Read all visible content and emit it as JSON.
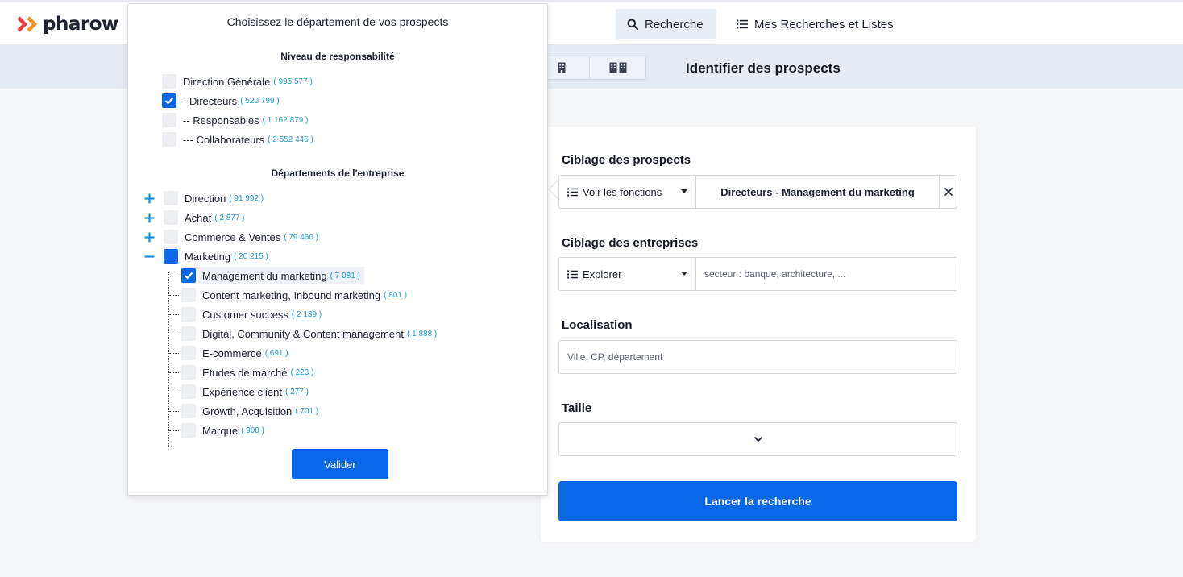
{
  "brand": {
    "name": "pharow",
    "colors": {
      "primary": "#0a67e8",
      "logo_red": "#ee3b3b",
      "logo_orange": "#f7931e",
      "count_blue": "#1b9bd1"
    }
  },
  "nav": {
    "search": {
      "label": "Recherche",
      "icon": "search-icon"
    },
    "lists": {
      "label": "Mes Recherches et Listes",
      "icon": "list-icon"
    }
  },
  "subheader": {
    "title": "Identifier des prospects",
    "view_icons": [
      "building-icon",
      "buildings-icon"
    ]
  },
  "card": {
    "prospects": {
      "title": "Ciblage des prospects",
      "dropdown": "Voir les fonctions",
      "selected": "Directeurs - Management du marketing"
    },
    "companies": {
      "title": "Ciblage des entreprises",
      "dropdown": "Explorer",
      "placeholder": "secteur : banque, architecture, ..."
    },
    "location": {
      "title": "Localisation",
      "placeholder": "Ville, CP, département"
    },
    "size": {
      "title": "Taille",
      "value": ""
    },
    "launch_label": "Lancer la recherche"
  },
  "modal": {
    "title": "Choisissez le département de vos prospects",
    "levels_title": "Niveau de responsabilité",
    "levels": [
      {
        "label": "Direction Générale",
        "count": "( 995 577 )",
        "checked": false
      },
      {
        "label": "- Directeurs",
        "count": "( 520 799 )",
        "checked": true
      },
      {
        "label": "-- Responsables",
        "count": "( 1 162 879 )",
        "checked": false
      },
      {
        "label": "--- Collaborateurs",
        "count": "( 2 552 446 )",
        "checked": false
      }
    ],
    "departments_title": "Départements de l'entreprise",
    "departments": [
      {
        "label": "Direction",
        "count": "( 91 992 )",
        "expander": "+"
      },
      {
        "label": "Achat",
        "count": "( 2 877 )",
        "expander": "+"
      },
      {
        "label": "Commerce & Ventes",
        "count": "( 79 460 )",
        "expander": "+"
      },
      {
        "label": "Marketing",
        "count": "( 20 215 )",
        "expander": "−",
        "state": "partial"
      }
    ],
    "sub_departments": [
      {
        "label": "Management du marketing",
        "count": "( 7 081 )",
        "checked": true
      },
      {
        "label": "Content marketing, Inbound marketing",
        "count": "( 801 )",
        "checked": false
      },
      {
        "label": "Customer success",
        "count": "( 2 139 )",
        "checked": false
      },
      {
        "label": "Digital, Community & Content management",
        "count": "( 1 888 )",
        "checked": false
      },
      {
        "label": "E-commerce",
        "count": "( 691 )",
        "checked": false
      },
      {
        "label": "Etudes de marché",
        "count": "( 223 )",
        "checked": false
      },
      {
        "label": "Expérience client",
        "count": "( 277 )",
        "checked": false
      },
      {
        "label": "Growth, Acquisition",
        "count": "( 701 )",
        "checked": false
      },
      {
        "label": "Marque",
        "count": "( 908 )",
        "checked": false
      }
    ],
    "submit_label": "Valider"
  }
}
